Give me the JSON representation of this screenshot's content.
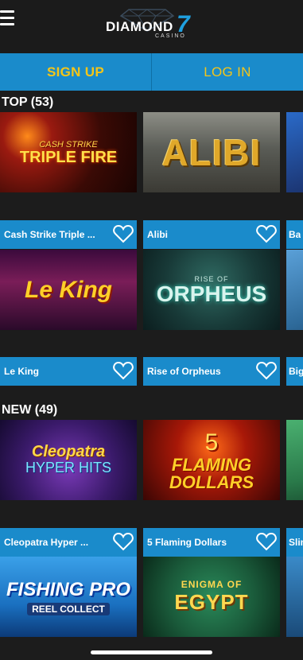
{
  "header": {
    "menu_icon": "hamburger-menu-icon",
    "logo_word": "DIAMOND",
    "logo_seven": "7",
    "logo_sub": "CASINO"
  },
  "auth": {
    "signup_label": "SIGN UP",
    "login_label": "LOG IN"
  },
  "colors": {
    "accent_blue": "#1a8bcb",
    "cta_yellow": "#f5c518",
    "background": "#1c1c1c"
  },
  "top": {
    "title": "TOP (53)",
    "row1": [
      {
        "name": "Cash Strike Triple ...",
        "thumb_top": "CASH STRIKE",
        "thumb_main": "TRIPLE FIRE"
      },
      {
        "name": "Alibi",
        "thumb_main": "ALIBI"
      },
      {
        "name": "Ba"
      }
    ],
    "row2": [
      {
        "name": "Le King",
        "thumb_main": "Le King"
      },
      {
        "name": "Rise of Orpheus",
        "thumb_top": "RISE OF",
        "thumb_main": "ORPHEUS"
      },
      {
        "name": "Big"
      }
    ]
  },
  "new": {
    "title": "NEW (49)",
    "row1": [
      {
        "name": "Cleopatra Hyper ...",
        "thumb_main": "Cleopatra",
        "thumb_sub": "HYPER HITS"
      },
      {
        "name": "5 Flaming Dollars",
        "thumb_top": "5",
        "thumb_main": "FLAMING DOLLARS"
      },
      {
        "name": "Slin"
      }
    ],
    "row2": [
      {
        "thumb_main": "FISHING PRO",
        "thumb_sub": "REEL COLLECT"
      },
      {
        "thumb_top": "ENIGMA OF",
        "thumb_main": "EGYPT"
      }
    ]
  }
}
